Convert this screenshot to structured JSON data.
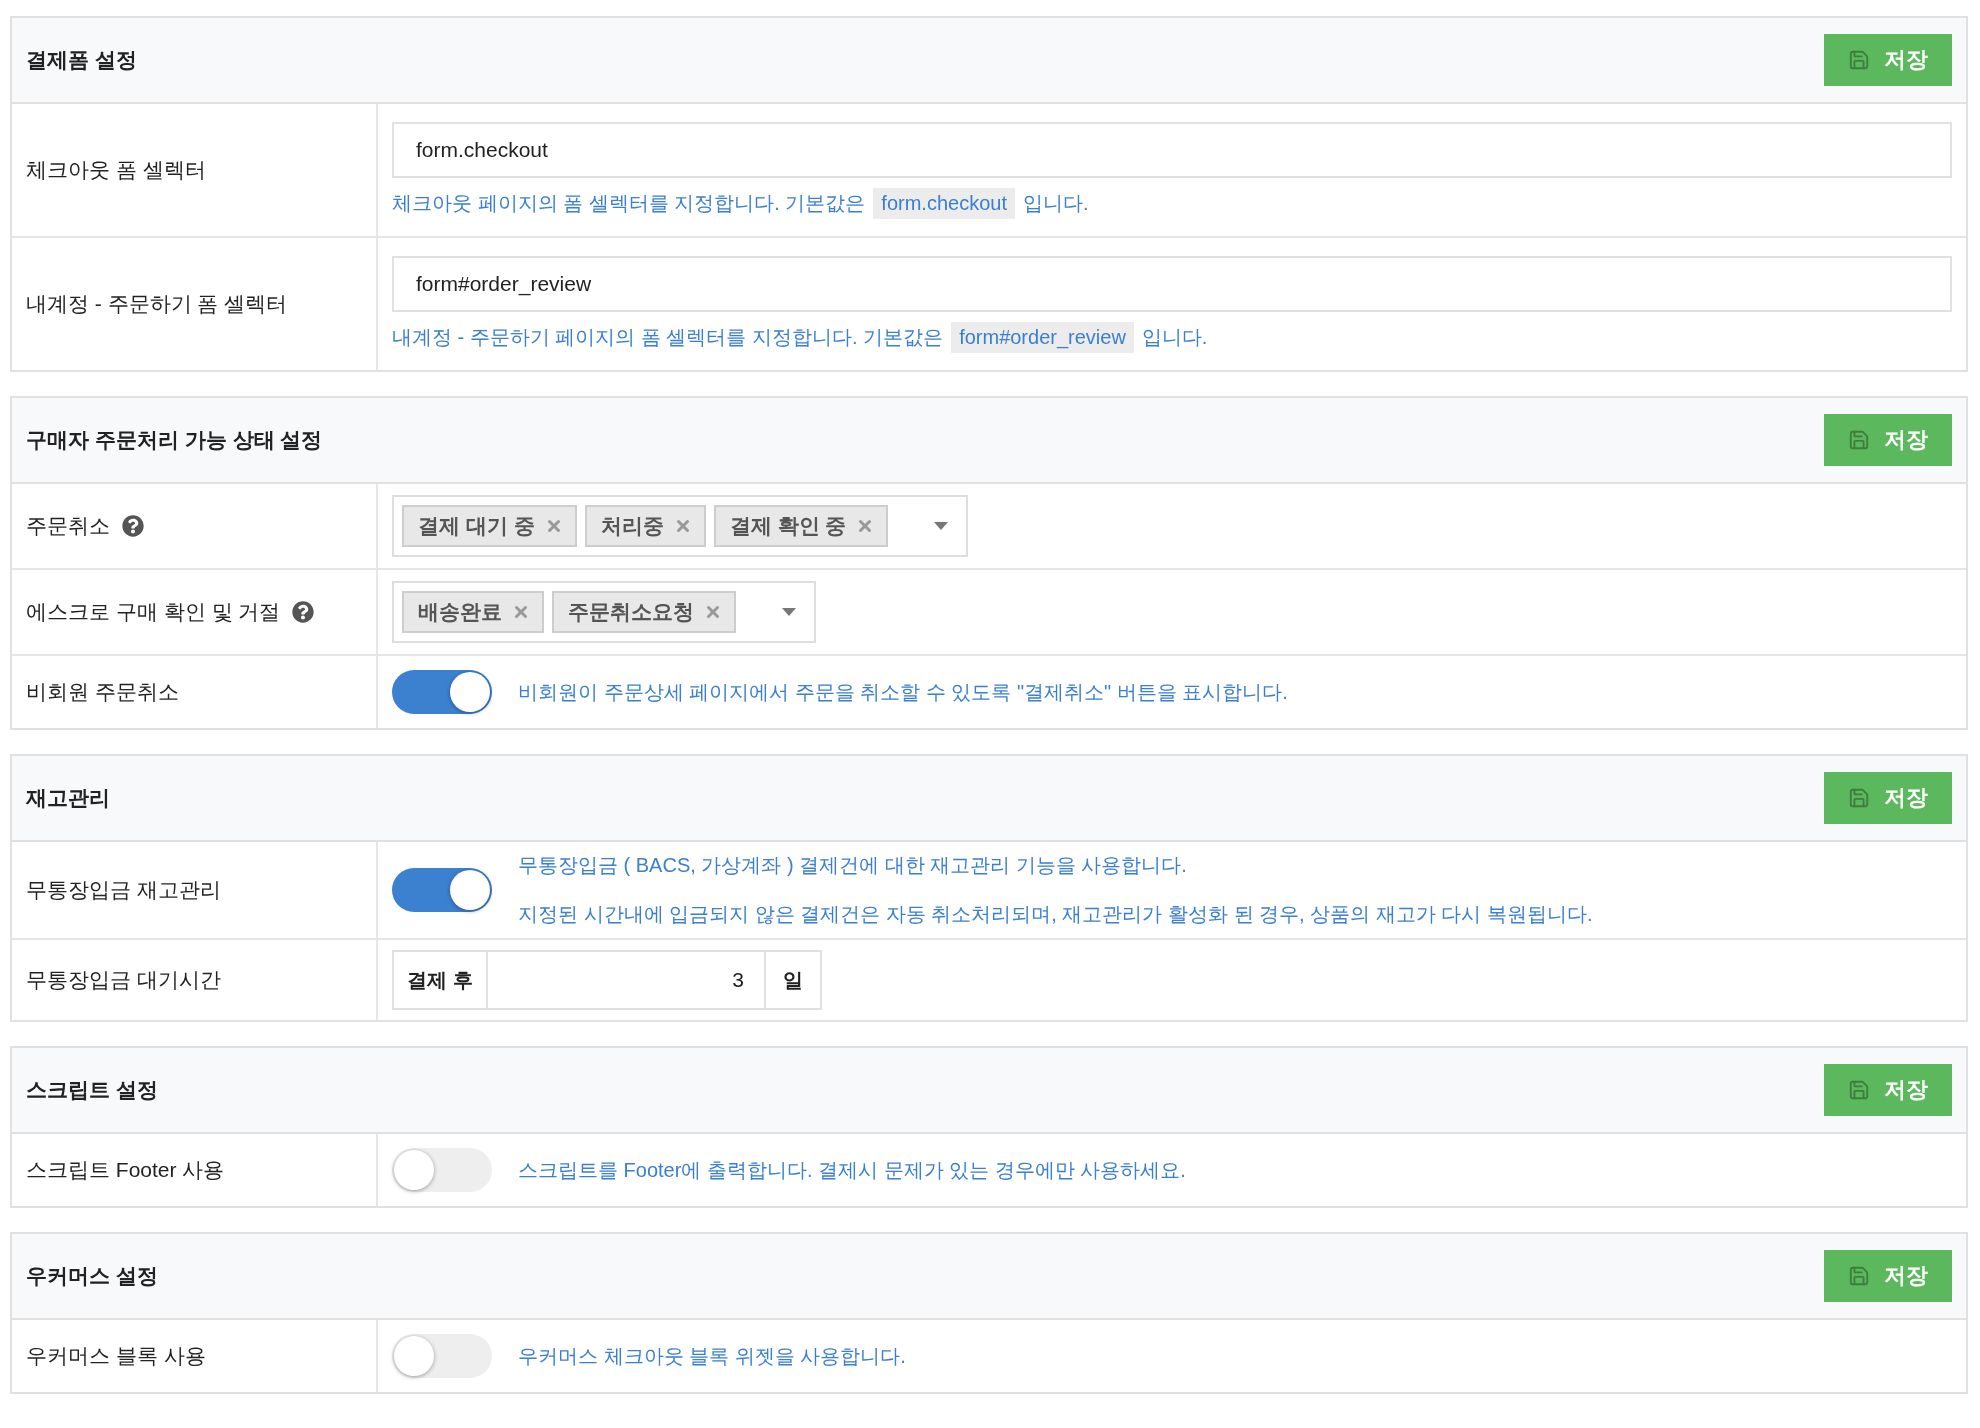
{
  "sections": [
    {
      "title": "결제폼 설정",
      "save_label": "저장",
      "rows": [
        {
          "kind": "input",
          "label": "체크아웃 폼 셀렉터",
          "value": "form.checkout",
          "hint_before": "체크아웃 페이지의 폼 셀렉터를 지정합니다. 기본값은",
          "hint_code": "form.checkout",
          "hint_after": "입니다."
        },
        {
          "kind": "input",
          "label": "내계정 - 주문하기 폼 셀렉터",
          "value": "form#order_review",
          "hint_before": "내계정 - 주문하기 페이지의 폼 셀렉터를 지정합니다. 기본값은",
          "hint_code": "form#order_review",
          "hint_after": "입니다."
        }
      ]
    },
    {
      "title": "구매자 주문처리 가능 상태 설정",
      "save_label": "저장",
      "rows": [
        {
          "kind": "tags",
          "label": "주문취소",
          "help": true,
          "tags": [
            "결제 대기 중",
            "처리중",
            "결제 확인 중"
          ]
        },
        {
          "kind": "tags",
          "label": "에스크로 구매 확인 및 거절",
          "help": true,
          "tags": [
            "배송완료",
            "주문취소요청"
          ]
        },
        {
          "kind": "toggle",
          "label": "비회원 주문취소",
          "on": true,
          "descriptions": [
            "비회원이 주문상세 페이지에서 주문을 취소할 수 있도록 \"결제취소\" 버튼을 표시합니다."
          ]
        }
      ]
    },
    {
      "title": "재고관리",
      "save_label": "저장",
      "rows": [
        {
          "kind": "toggle",
          "label": "무통장입금 재고관리",
          "on": true,
          "descriptions": [
            "무통장입금 ( BACS, 가상계좌 ) 결제건에 대한 재고관리 기능을 사용합니다.",
            "지정된 시간내에 입금되지 않은 결제건은 자동 취소처리되며, 재고관리가 활성화 된 경우, 상품의 재고가 다시 복원됩니다."
          ]
        },
        {
          "kind": "addon",
          "label": "무통장입금 대기시간",
          "prefix": "결제 후",
          "value": "3",
          "suffix": "일"
        }
      ]
    },
    {
      "title": "스크립트 설정",
      "save_label": "저장",
      "rows": [
        {
          "kind": "toggle",
          "label": "스크립트 Footer 사용",
          "on": false,
          "descriptions": [
            "스크립트를 Footer에 출력합니다. 결제시 문제가 있는 경우에만 사용하세요."
          ]
        }
      ]
    },
    {
      "title": "우커머스 설정",
      "save_label": "저장",
      "rows": [
        {
          "kind": "toggle",
          "label": "우커머스 블록 사용",
          "on": false,
          "descriptions": [
            "우커머스 체크아웃 블록 위젯을 사용합니다."
          ]
        }
      ]
    }
  ]
}
